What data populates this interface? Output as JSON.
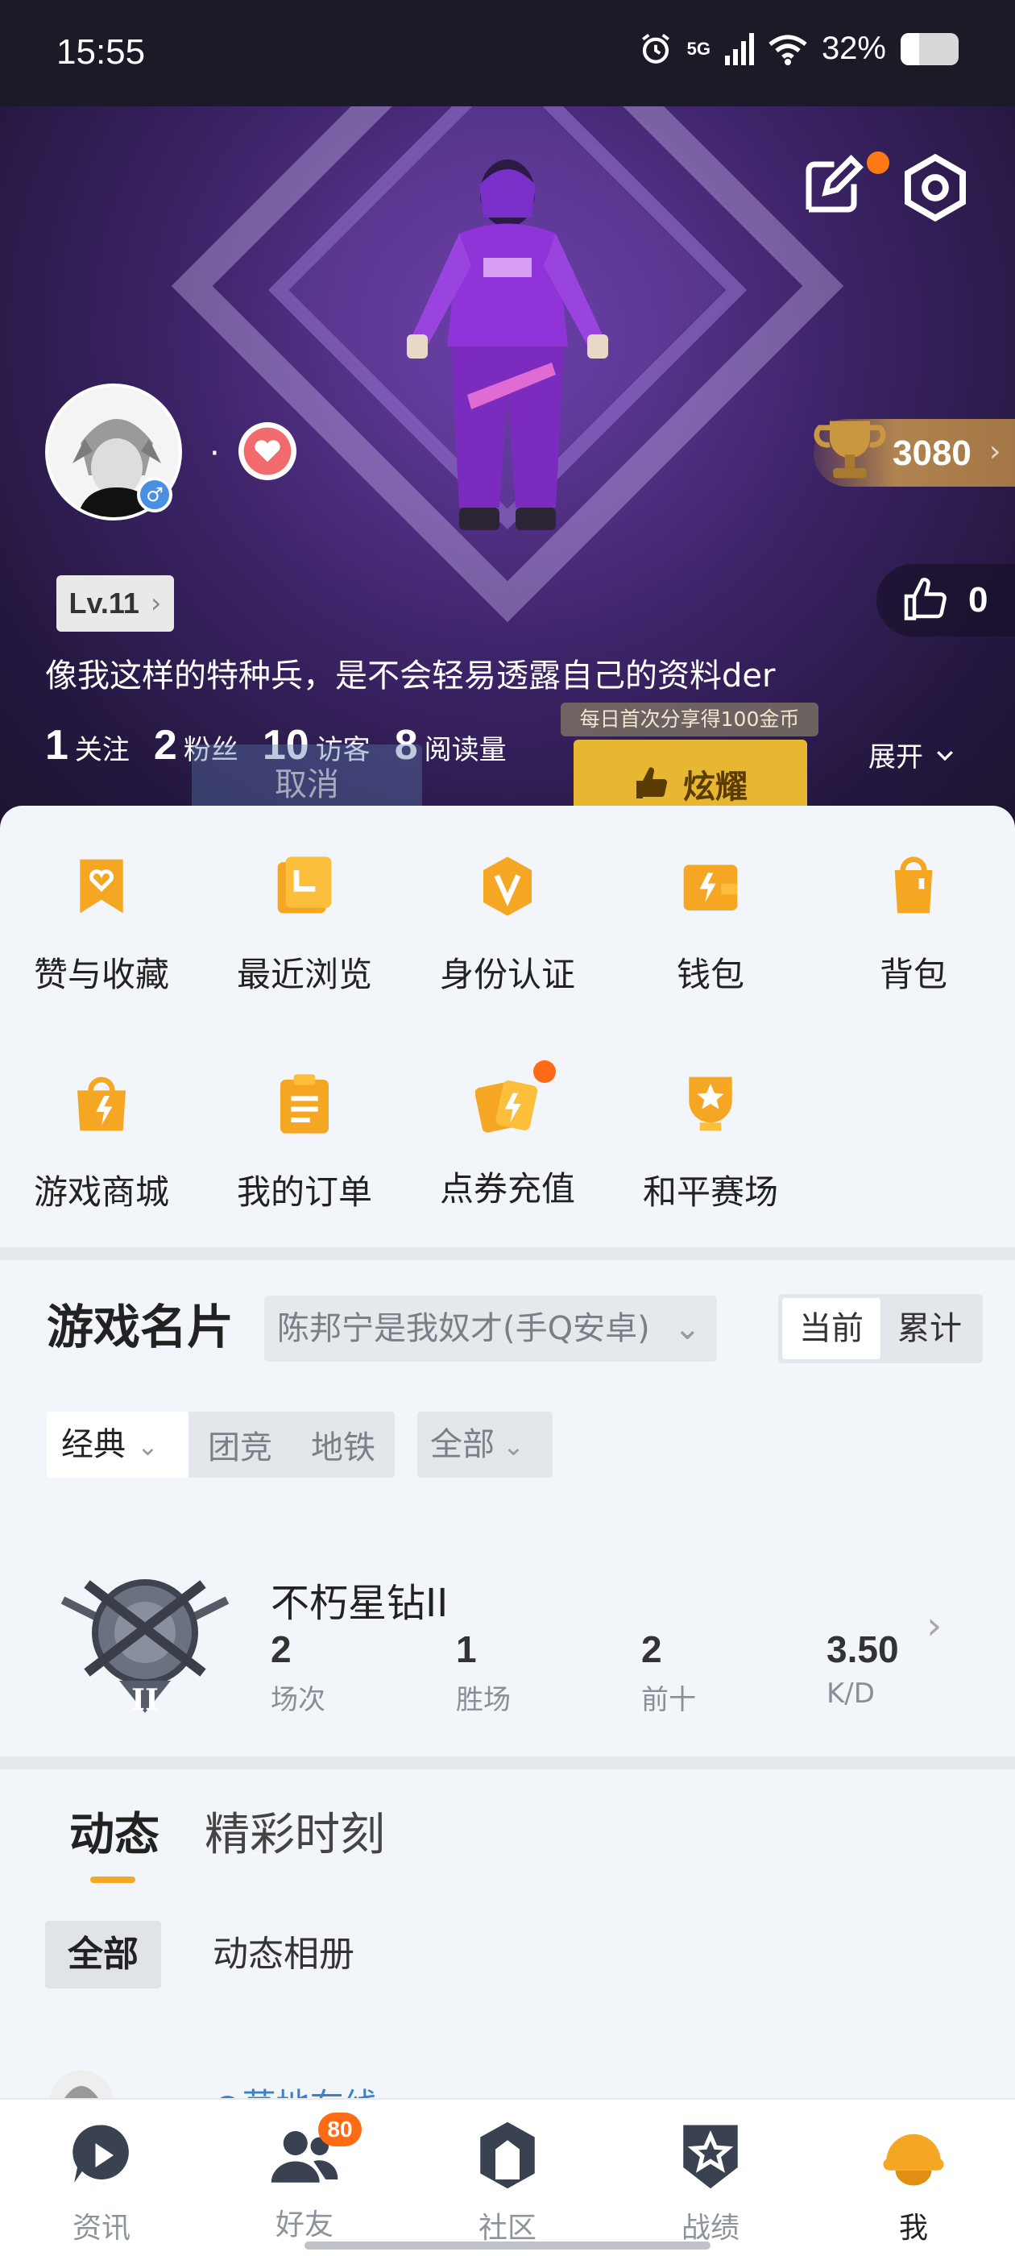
{
  "status_bar": {
    "time": "15:55",
    "network": "5G",
    "battery": "32%",
    "battery_level": 0.32
  },
  "profile": {
    "nickname": "·",
    "trophy_score": "3080",
    "level": "Lv.11",
    "likes": "0",
    "bio": "像我这样的特种兵，是不会轻易透露自己的资料der",
    "stats": [
      {
        "value": "1",
        "label": "关注"
      },
      {
        "value": "2",
        "label": "粉丝"
      },
      {
        "value": "10",
        "label": "访客"
      },
      {
        "value": "8",
        "label": "阅读量"
      }
    ],
    "expand_label": "展开",
    "share_tip": "每日首次分享得100金币",
    "share_button": "炫耀",
    "cancel_ghost": "取消"
  },
  "grid_menu": [
    {
      "label": "赞与收藏",
      "icon": "heart-bookmark-icon"
    },
    {
      "label": "最近浏览",
      "icon": "history-icon"
    },
    {
      "label": "身份认证",
      "icon": "verify-icon"
    },
    {
      "label": "钱包",
      "icon": "wallet-icon"
    },
    {
      "label": "背包",
      "icon": "backpack-icon"
    },
    {
      "label": "游戏商城",
      "icon": "shop-bag-icon"
    },
    {
      "label": "我的订单",
      "icon": "order-icon"
    },
    {
      "label": "点券充值",
      "icon": "coupon-icon"
    },
    {
      "label": "和平赛场",
      "icon": "trophy-cup-icon"
    }
  ],
  "game_card": {
    "title": "游戏名片",
    "account": "陈邦宁是我奴才(手Q安卓)",
    "segments": [
      "当前",
      "累计"
    ],
    "mode": "经典",
    "mode_tabs": [
      "团竞",
      "地铁"
    ],
    "filter": "全部",
    "rank_name": "不朽星钻II",
    "rank_stats": [
      {
        "value": "2",
        "label": "场次"
      },
      {
        "value": "1",
        "label": "胜场"
      },
      {
        "value": "2",
        "label": "前十"
      },
      {
        "value": "3.50",
        "label": "K/D"
      }
    ]
  },
  "feed": {
    "tabs": [
      "动态",
      "精彩时刻"
    ],
    "sub_tabs": [
      "全部",
      "动态相册"
    ],
    "post_author": "●草地在线"
  },
  "bottom_nav": [
    {
      "label": "资讯",
      "icon": "news-play-icon"
    },
    {
      "label": "好友",
      "icon": "friends-icon",
      "badge": "80"
    },
    {
      "label": "社区",
      "icon": "community-icon"
    },
    {
      "label": "战绩",
      "icon": "record-badge-icon"
    },
    {
      "label": "我",
      "icon": "helmet-icon"
    }
  ],
  "colors": {
    "accent": "#f5a623",
    "dot": "#ff6a14",
    "link": "#3b82c4",
    "hero_bg": "#3d2469"
  }
}
